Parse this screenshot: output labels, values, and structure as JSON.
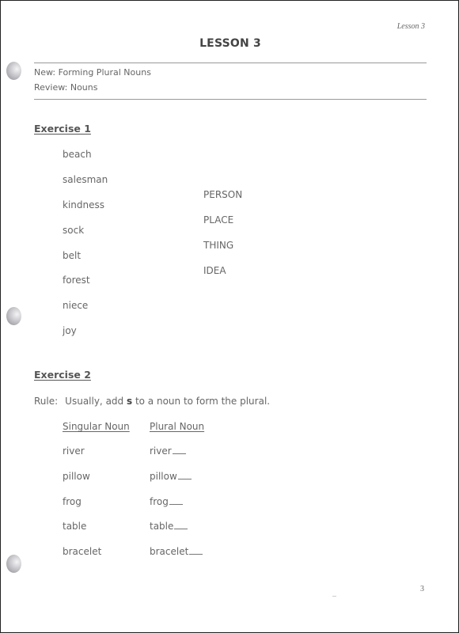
{
  "running_head": "Lesson 3",
  "title": "LESSON 3",
  "new_topic": "New: Forming Plural Nouns",
  "review_topic": "Review: Nouns",
  "exercise1": {
    "heading": "Exercise 1",
    "words": [
      "beach",
      "salesman",
      "kindness",
      "sock",
      "belt",
      "forest",
      "niece",
      "joy"
    ],
    "categories": [
      "PERSON",
      "PLACE",
      "THING",
      "IDEA"
    ]
  },
  "exercise2": {
    "heading": "Exercise 2",
    "rule_label": "Rule:",
    "rule_before": "Usually, add ",
    "rule_bold": "s",
    "rule_after": " to a noun to form the plural.",
    "col_singular": "Singular Noun",
    "col_plural": "Plural Noun",
    "rows": [
      {
        "singular": "river",
        "plural": "river"
      },
      {
        "singular": "pillow",
        "plural": "pillow"
      },
      {
        "singular": "frog",
        "plural": "frog"
      },
      {
        "singular": "table",
        "plural": "table"
      },
      {
        "singular": "bracelet",
        "plural": "bracelet"
      }
    ]
  },
  "page_number": "3"
}
